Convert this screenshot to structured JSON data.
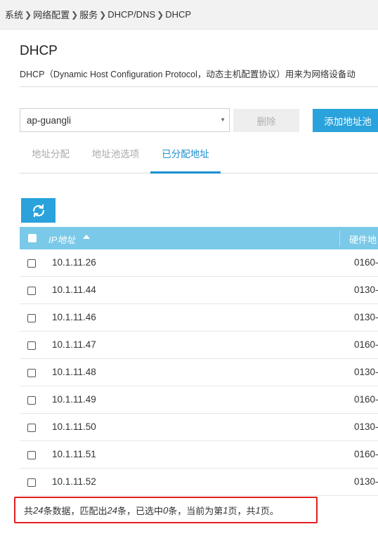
{
  "breadcrumb": {
    "items": [
      "系统",
      "网络配置",
      "服务",
      "DHCP/DNS",
      "DHCP"
    ]
  },
  "page": {
    "title": "DHCP",
    "description": "DHCP（Dynamic Host Configuration Protocol，动态主机配置协议）用来为网络设备动"
  },
  "toolbar": {
    "pool_select_value": "ap-guangli",
    "delete_label": "删除",
    "add_label": "添加地址池"
  },
  "tabs": [
    "地址分配",
    "地址池选项",
    "已分配地址"
  ],
  "active_tab": 2,
  "table": {
    "headers": {
      "ip": "IP地址",
      "hw": "硬件地"
    },
    "rows": [
      {
        "ip": "10.1.11.26",
        "hw": "0160-"
      },
      {
        "ip": "10.1.11.44",
        "hw": "0130-"
      },
      {
        "ip": "10.1.11.46",
        "hw": "0130-"
      },
      {
        "ip": "10.1.11.47",
        "hw": "0160-"
      },
      {
        "ip": "10.1.11.48",
        "hw": "0130-"
      },
      {
        "ip": "10.1.11.49",
        "hw": "0160-"
      },
      {
        "ip": "10.1.11.50",
        "hw": "0130-"
      },
      {
        "ip": "10.1.11.51",
        "hw": "0160-"
      },
      {
        "ip": "10.1.11.52",
        "hw": "0130-"
      }
    ]
  },
  "footer": {
    "p1": "共",
    "total": "24",
    "p2": "条数据，匹配出",
    "matched": "24",
    "p3": "条，已选中",
    "selected": "0",
    "p4": "条，当前为第",
    "page": "1",
    "p5": "页，共",
    "pages": "1",
    "p6": "页。"
  },
  "colors": {
    "accent": "#2aa2dc",
    "table_header": "#7ac9e8",
    "highlight_border": "#e02020"
  },
  "icons": [
    "chevron-right-icon",
    "dropdown-arrow-icon",
    "refresh-icon",
    "sort-asc-icon",
    "checkbox-icon"
  ]
}
